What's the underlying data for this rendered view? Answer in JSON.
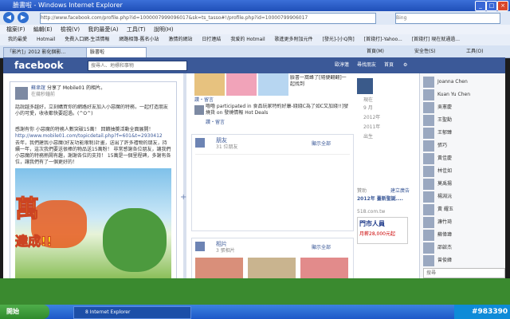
{
  "window": {
    "title": "臉書啦 - Windows Internet Explorer",
    "url": "http://www.facebook.com/profile.php?id=1000007999096017&sk=ts_tasso#!/profile.php?id=10000799906017",
    "search_placeholder": "Bing",
    "menu": [
      "檔案(F)",
      "編輯(E)",
      "檢視(V)",
      "我的最愛(A)",
      "工具(T)",
      "說明(H)"
    ],
    "favorites": [
      "我的最愛",
      "Hotmail",
      "免費入口網-生活情報",
      "網路相簿-舊名小站",
      "激情的網站",
      "日打連結",
      "我爱的 Hotmail",
      "歌進更多附加元件",
      "[發光]-[小Q狗]",
      "[首錢打]-Yahoo...",
      "[首錢打] 現在就通過..."
    ],
    "tabs": [
      "「影片]」2012 影化個影...",
      "臉書啦"
    ],
    "cmd_items": [
      "首頁(M)",
      "安全性(S)",
      "工具(O)"
    ]
  },
  "facebook": {
    "logo": "facebook",
    "search_placeholder": "搜尋人、地標和事物",
    "nav": [
      "歐淳蓮",
      "尋找朋友",
      "首頁"
    ],
    "left_post": {
      "author": "蘇聿誼",
      "action": "分享了 Mobile01 的相片。",
      "time": "在幾秒鐘前",
      "text1": "話說越多越好，立刻購買你的網路好友加入小惡魔的特務，一起打造朋友小的可愛，收收都快要超過。(^O^)",
      "text2": "感謝有你 小惡魔的特務人數突破15萬！ 回饋抽獎活動全面展開！",
      "link": "http://www.mobile01.com/topicdetail.php?f=601&t=2930412",
      "text3": "去年，我們建我小惡魔(好友功能限制)計畫，送出了許多禮物的朋友，持續一年，這次我們要送很棒的物品送15萬粉！ 非常感謝各位朋友，讓我們小惡魔的特務熱鬧有趣，謝謝各位的支持！ 15萬是一個里程碑，多謝有各位，讓我們有了一個更好的！",
      "image_text": "萬",
      "image_text2": "達成!!"
    },
    "mid_top": {
      "text1": "臉書一窩蜂了[隨便翻翻]一起找到",
      "actions": "讚・留言",
      "text2": "嚕嚕 participated in 食品玩家特約好康-錢錢C為了如C又加錢!!]發燒貨 on 發燒情報 Hot Deals",
      "actions2": "讚・留言"
    },
    "friends_card": {
      "title": "朋友",
      "count": "31 位朋友",
      "link": "顯示全部"
    },
    "photos_card": {
      "title": "相片",
      "count": "3 張相片",
      "link": "顯示全部"
    },
    "timeline_years": [
      "現在",
      "9 月",
      "2012年",
      "2011年",
      "出生"
    ],
    "ad": {
      "label": "贊助",
      "more": "建立廣告",
      "headline": "2012年 臺新聖誕....",
      "url": "518.com.tw",
      "body1": "門市人員",
      "body2": "月薪28,000元起"
    },
    "chat_list": [
      "Joanna Chen",
      "Kuan Yu Chen",
      "吳憲慶",
      "王聖勳",
      "王郁臻",
      "張巧",
      "黃佳慶",
      "林佳如",
      "莫禹揚",
      "楊淵沅",
      "黃 耀玉",
      "濂竹琦",
      "蘇偉瑋",
      "邵啟杰",
      "曾俊緯"
    ],
    "chat_search": "搜尋"
  },
  "taskbar": {
    "start": "開始",
    "item": "8 Internet Explorer",
    "watermark": "#983390"
  }
}
